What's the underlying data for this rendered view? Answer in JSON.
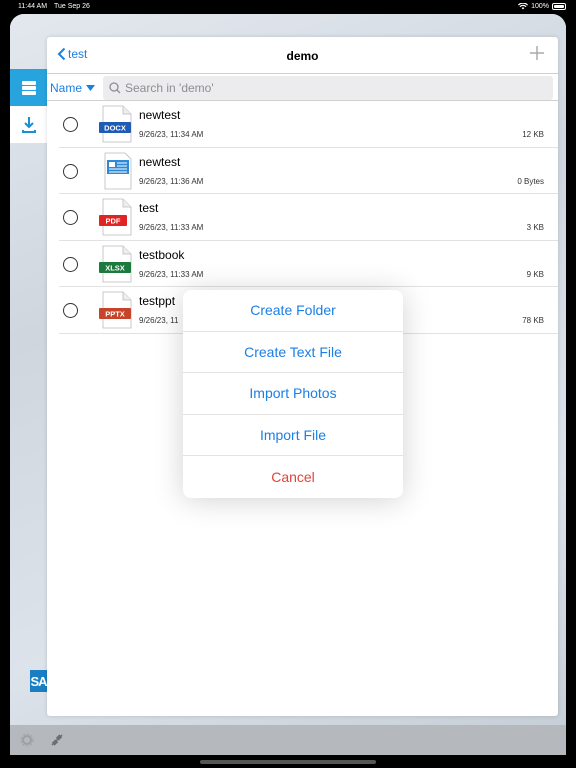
{
  "status_bar": {
    "time": "11:44 AM",
    "date": "Tue Sep 26",
    "battery_label": "100%"
  },
  "nav": {
    "back_label": "test",
    "title": "demo",
    "add_icon": "plus-icon"
  },
  "toolbar": {
    "sort_label": "Name",
    "search_placeholder": "Search in 'demo'"
  },
  "files": [
    {
      "name": "newtest",
      "date": "9/26/23, 11:34 AM",
      "size": "12 KB",
      "type_label": "DOCX",
      "type_color": "#1f5bb4"
    },
    {
      "name": "newtest",
      "date": "9/26/23, 11:36 AM",
      "size": "0 Bytes",
      "type_label": "",
      "type_color": "#2e8ad6"
    },
    {
      "name": "test",
      "date": "9/26/23, 11:33 AM",
      "size": "3 KB",
      "type_label": "PDF",
      "type_color": "#e02424"
    },
    {
      "name": "testbook",
      "date": "9/26/23, 11:33 AM",
      "size": "9 KB",
      "type_label": "XLSX",
      "type_color": "#1d7a3e"
    },
    {
      "name": "testppt",
      "date": "9/26/23, 11",
      "size": "78 KB",
      "type_label": "PPTX",
      "type_color": "#c6452a"
    }
  ],
  "popover": {
    "items": [
      "Create Folder",
      "Create Text File",
      "Import Photos",
      "Import File"
    ],
    "cancel": "Cancel"
  },
  "branding": {
    "logo_text": "SA"
  },
  "colors": {
    "accent": "#1a7fe6",
    "rail_active": "#27a4dd",
    "cancel": "#e0443a"
  }
}
